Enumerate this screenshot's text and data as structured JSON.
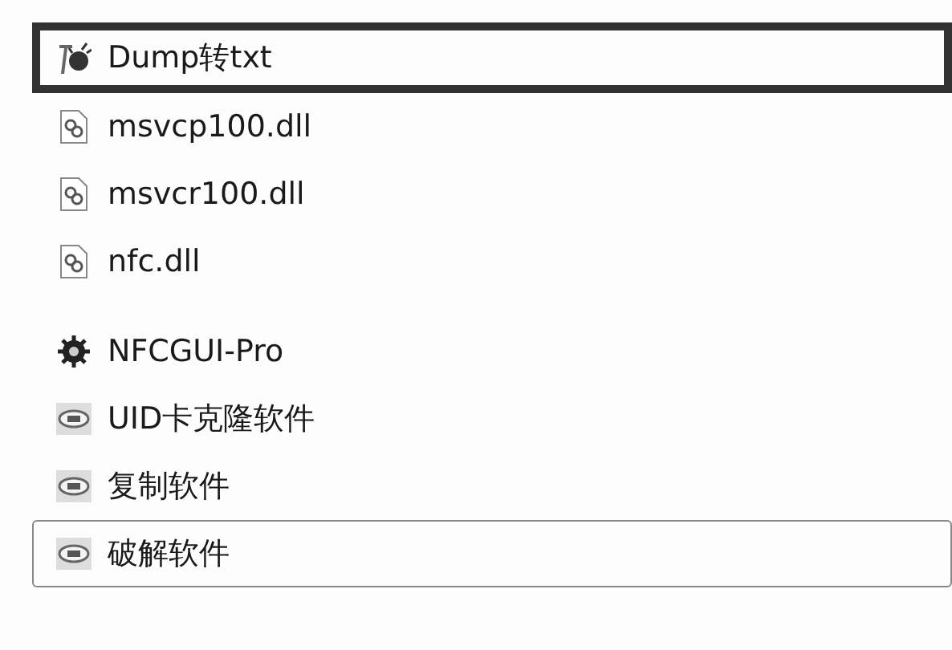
{
  "files": [
    {
      "name": "Dump转txt",
      "kind": "app",
      "highlighted": true,
      "focused": false
    },
    {
      "name": "msvcp100.dll",
      "kind": "dll",
      "highlighted": false,
      "focused": false
    },
    {
      "name": "msvcr100.dll",
      "kind": "dll",
      "highlighted": false,
      "focused": false
    },
    {
      "name": "nfc.dll",
      "kind": "dll",
      "highlighted": false,
      "focused": false
    },
    {
      "name": "NFCGUI-Pro",
      "kind": "gear",
      "highlighted": false,
      "focused": false
    },
    {
      "name": "UID卡克隆软件",
      "kind": "card",
      "highlighted": false,
      "focused": false
    },
    {
      "name": "复制软件",
      "kind": "card",
      "highlighted": false,
      "focused": false
    },
    {
      "name": "破解软件",
      "kind": "card",
      "highlighted": false,
      "focused": true
    }
  ]
}
